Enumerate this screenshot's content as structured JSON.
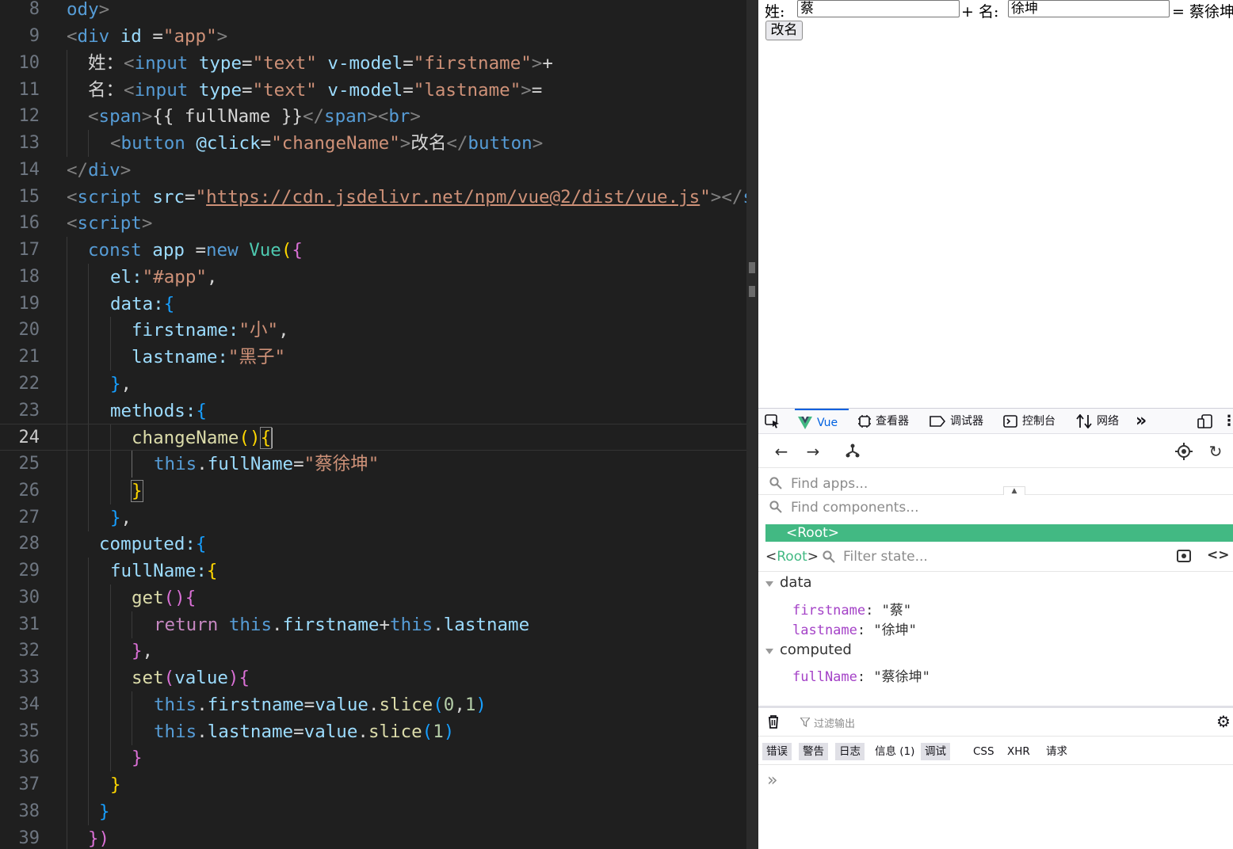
{
  "editor": {
    "line_numbers": [
      "8",
      "9",
      "10",
      "11",
      "12",
      "13",
      "14",
      "15",
      "16",
      "17",
      "18",
      "19",
      "20",
      "21",
      "22",
      "23",
      "24",
      "25",
      "26",
      "27",
      "28",
      "29",
      "30",
      "31",
      "32",
      "33",
      "34",
      "35",
      "36",
      "37",
      "38",
      "39"
    ],
    "active_line": "24",
    "tokens": {
      "l8": [
        "ody",
        ">"
      ],
      "l9": [
        "<",
        "div",
        "id",
        "=",
        "\"app\"",
        ">"
      ],
      "l10": [
        "姓：",
        "<",
        "input",
        "type",
        "=",
        "\"text\"",
        "v-model",
        "=",
        "\"firstname\"",
        ">",
        "+"
      ],
      "l11": [
        "名：",
        "<",
        "input",
        "type",
        "=",
        "\"text\"",
        "v-model",
        "=",
        "\"lastname\"",
        ">",
        "="
      ],
      "l12": [
        "<",
        "span",
        ">",
        "{{ fullName }}",
        "</",
        "span",
        "><",
        "br",
        ">"
      ],
      "l13": [
        "<",
        "button",
        "@click",
        "=",
        "\"changeName\"",
        ">",
        "改名",
        "</",
        "button",
        ">"
      ],
      "l14": [
        "</",
        "div",
        ">"
      ],
      "l15": [
        "<",
        "script",
        "src",
        "=",
        "\"",
        "https://cdn.jsdelivr.net/npm/vue@2/dist/vue.js",
        "\"",
        "></",
        "s"
      ],
      "l16": [
        "<",
        "script",
        ">"
      ],
      "l17": [
        "const",
        "app",
        "=",
        "new",
        "Vue",
        "(",
        "{"
      ],
      "l18": [
        "el:",
        "\"#app\"",
        ","
      ],
      "l19": [
        "data:",
        "{"
      ],
      "l20": [
        "firstname:",
        "\"小\"",
        ","
      ],
      "l21": [
        "lastname:",
        "\"黑子\""
      ],
      "l22": [
        "}",
        ","
      ],
      "l23": [
        "methods:",
        "{"
      ],
      "l24": [
        "changeName",
        "()",
        "{"
      ],
      "l25": [
        "this",
        ".",
        "fullName",
        "=",
        "\"蔡徐坤\""
      ],
      "l26": [
        "}"
      ],
      "l27": [
        "}",
        ","
      ],
      "l28": [
        "computed:",
        "{"
      ],
      "l29": [
        "fullName:",
        "{"
      ],
      "l30": [
        "get",
        "()",
        "{"
      ],
      "l31": [
        "return",
        "this",
        ".",
        "firstname",
        "+",
        "this",
        ".",
        "lastname"
      ],
      "l32": [
        "}",
        ","
      ],
      "l33": [
        "set",
        "(",
        "value",
        ")",
        "{"
      ],
      "l34": [
        "this",
        ".",
        "firstname",
        "=",
        "value",
        ".",
        "slice",
        "(",
        "0",
        ",",
        "1",
        ")"
      ],
      "l35": [
        "this",
        ".",
        "lastname",
        "=",
        "value",
        ".",
        "slice",
        "(",
        "1",
        ")"
      ],
      "l36": [
        "}"
      ],
      "l37": [
        "}"
      ],
      "l38": [
        "}"
      ],
      "l39": [
        "})"
      ]
    }
  },
  "page": {
    "surname_label": "姓:",
    "surname_value": "蔡",
    "plus_given_label": "+ 名:",
    "given_value": "徐坤",
    "result_text": "= 蔡徐坤",
    "rename_button": "改名"
  },
  "devtools": {
    "tabs": [
      {
        "label": "Vue",
        "icon": "vue-logo-icon",
        "selected": true
      },
      {
        "label": "查看器",
        "icon": "inspector-icon"
      },
      {
        "label": "调试器",
        "icon": "debugger-icon"
      },
      {
        "label": "控制台",
        "icon": "console-icon"
      },
      {
        "label": "网络",
        "icon": "network-icon"
      },
      {
        "label": "»",
        "icon": "overflow-chevron-icon"
      }
    ],
    "vue": {
      "find_apps_placeholder": "Find apps...",
      "find_components_placeholder": "Find components...",
      "root_component": "<Root>",
      "selected_prefix": "Root",
      "filter_state_placeholder": "Filter state...",
      "data_section": "data",
      "computed_section": "computed",
      "data": [
        {
          "key": "firstname",
          "value": "\"蔡\""
        },
        {
          "key": "lastname",
          "value": "\"徐坤\""
        }
      ],
      "computed": [
        {
          "key": "fullName",
          "value": "\"蔡徐坤\""
        }
      ]
    },
    "console": {
      "filter_placeholder": "过滤输出",
      "categories": [
        {
          "label": "错误",
          "on": true
        },
        {
          "label": "警告",
          "on": true
        },
        {
          "label": "日志",
          "on": true
        },
        {
          "label": "信息 (1)",
          "on": false
        },
        {
          "label": "调试",
          "on": true
        },
        {
          "label": "CSS",
          "on": false
        },
        {
          "label": "XHR",
          "on": false
        },
        {
          "label": "请求",
          "on": false
        }
      ],
      "prompt": "»"
    }
  },
  "colors": {
    "editor_bg": "#1f1f1f",
    "vue_green": "#42b983",
    "tab_accent": "#0061e0"
  }
}
